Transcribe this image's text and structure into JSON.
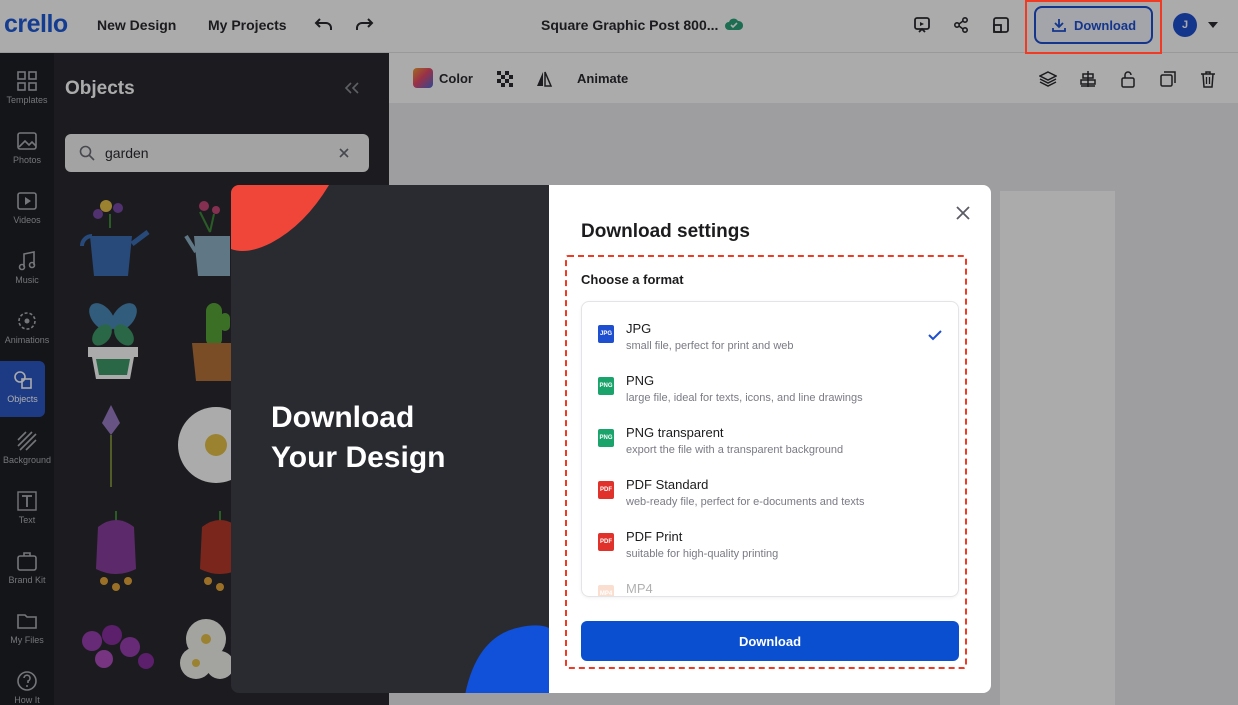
{
  "header": {
    "logo": "crello",
    "new_design": "New Design",
    "my_projects": "My Projects",
    "doc_title": "Square Graphic Post 800...",
    "download_label": "Download",
    "avatar_initial": "J"
  },
  "rail": {
    "items": [
      {
        "label": "Templates",
        "icon": "templates-icon"
      },
      {
        "label": "Photos",
        "icon": "photos-icon"
      },
      {
        "label": "Videos",
        "icon": "videos-icon"
      },
      {
        "label": "Music",
        "icon": "music-icon"
      },
      {
        "label": "Animations",
        "icon": "animations-icon"
      },
      {
        "label": "Objects",
        "icon": "objects-icon"
      },
      {
        "label": "Background",
        "icon": "background-icon"
      },
      {
        "label": "Text",
        "icon": "text-icon"
      },
      {
        "label": "Brand Kit",
        "icon": "brand-kit-icon"
      },
      {
        "label": "My Files",
        "icon": "my-files-icon"
      },
      {
        "label": "How It",
        "icon": "help-icon"
      }
    ]
  },
  "panel": {
    "title": "Objects",
    "search_value": "garden"
  },
  "toolbar": {
    "color_label": "Color",
    "animate_label": "Animate"
  },
  "promo": {
    "line1": "Download",
    "line2": "Your Design"
  },
  "modal": {
    "title": "Download settings",
    "format_label": "Choose a format",
    "formats": [
      {
        "name": "JPG",
        "desc": "small file, perfect for print and web",
        "badge": "JPG",
        "color": "#1f4fd1",
        "selected": true
      },
      {
        "name": "PNG",
        "desc": "large file, ideal for texts, icons, and line drawings",
        "badge": "PNG",
        "color": "#1aa36a",
        "selected": false
      },
      {
        "name": "PNG transparent",
        "desc": "export the file with a transparent background",
        "badge": "PNG",
        "color": "#1aa36a",
        "selected": false
      },
      {
        "name": "PDF Standard",
        "desc": "web-ready file, perfect for e-documents and texts",
        "badge": "PDF",
        "color": "#e0322a",
        "selected": false
      },
      {
        "name": "PDF Print",
        "desc": "suitable for high-quality printing",
        "badge": "PDF",
        "color": "#e0322a",
        "selected": false
      },
      {
        "name": "MP4",
        "desc": "",
        "badge": "MP4",
        "color": "#f0a27a",
        "selected": false
      }
    ],
    "download_button": "Download"
  },
  "colors": {
    "accent": "#0b4fd1",
    "highlight": "#f03a24",
    "dark_panel": "#2a2b31"
  }
}
